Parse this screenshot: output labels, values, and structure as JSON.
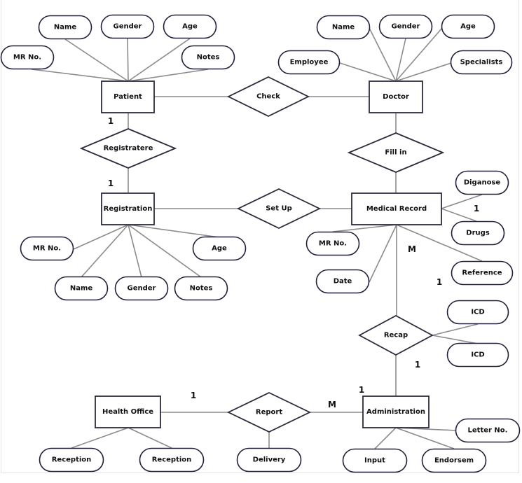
{
  "diagram": {
    "type": "entity-relationship",
    "colors": {
      "shape_stroke": "#2b2b3d",
      "connector": "#8c8c8c",
      "text": "#111111",
      "background": "#ffffff"
    },
    "entities": [
      {
        "id": "patient",
        "label": "Patient"
      },
      {
        "id": "doctor",
        "label": "Doctor"
      },
      {
        "id": "registration",
        "label": "Registration"
      },
      {
        "id": "medical_record",
        "label": "Medical Record"
      },
      {
        "id": "health_office",
        "label": "Health Office"
      },
      {
        "id": "administration",
        "label": "Administration"
      }
    ],
    "relationships": [
      {
        "id": "check",
        "label": "Check",
        "connects": [
          "patient",
          "doctor"
        ]
      },
      {
        "id": "registratere",
        "label": "Registratere",
        "connects": [
          "patient",
          "registration"
        ]
      },
      {
        "id": "fill_in",
        "label": "Fill in",
        "connects": [
          "doctor",
          "medical_record"
        ]
      },
      {
        "id": "set_up",
        "label": "Set Up",
        "connects": [
          "registration",
          "medical_record"
        ]
      },
      {
        "id": "recap",
        "label": "Recap",
        "connects": [
          "medical_record",
          "administration"
        ]
      },
      {
        "id": "report",
        "label": "Report",
        "connects": [
          "health_office",
          "administration"
        ]
      }
    ],
    "attributes": [
      {
        "id": "p_name",
        "label": "Name",
        "owner": "patient"
      },
      {
        "id": "p_gender",
        "label": "Gender",
        "owner": "patient"
      },
      {
        "id": "p_age",
        "label": "Age",
        "owner": "patient"
      },
      {
        "id": "p_mrno",
        "label": "MR No.",
        "owner": "patient"
      },
      {
        "id": "p_notes",
        "label": "Notes",
        "owner": "patient"
      },
      {
        "id": "d_name",
        "label": "Name",
        "owner": "doctor"
      },
      {
        "id": "d_gender",
        "label": "Gender",
        "owner": "doctor"
      },
      {
        "id": "d_age",
        "label": "Age",
        "owner": "doctor"
      },
      {
        "id": "d_employee",
        "label": "Employee",
        "owner": "doctor"
      },
      {
        "id": "d_specialists",
        "label": "Specialists",
        "owner": "doctor"
      },
      {
        "id": "r_mrno",
        "label": "MR No.",
        "owner": "registration"
      },
      {
        "id": "r_age",
        "label": "Age",
        "owner": "registration"
      },
      {
        "id": "r_name",
        "label": "Name",
        "owner": "registration"
      },
      {
        "id": "r_gender",
        "label": "Gender",
        "owner": "registration"
      },
      {
        "id": "r_notes",
        "label": "Notes",
        "owner": "registration"
      },
      {
        "id": "m_diganose",
        "label": "Diganose",
        "owner": "medical_record"
      },
      {
        "id": "m_drugs",
        "label": "Drugs",
        "owner": "medical_record"
      },
      {
        "id": "m_mrno",
        "label": "MR No.",
        "owner": "medical_record"
      },
      {
        "id": "m_reference",
        "label": "Reference",
        "owner": "medical_record"
      },
      {
        "id": "m_date",
        "label": "Date",
        "owner": "medical_record"
      },
      {
        "id": "rc_icd1",
        "label": "ICD",
        "owner": "recap"
      },
      {
        "id": "rc_icd2",
        "label": "ICD",
        "owner": "recap"
      },
      {
        "id": "a_letter",
        "label": "Letter No.",
        "owner": "administration"
      },
      {
        "id": "a_input",
        "label": "Input",
        "owner": "administration"
      },
      {
        "id": "a_endorsem",
        "label": "Endorsem",
        "owner": "administration"
      },
      {
        "id": "h_reception1",
        "label": "Reception",
        "owner": "health_office"
      },
      {
        "id": "h_reception2",
        "label": "Reception",
        "owner": "health_office"
      },
      {
        "id": "rp_delivery",
        "label": "Delivery",
        "owner": "report"
      }
    ],
    "cardinalities": [
      {
        "id": "c1",
        "label": "1",
        "near": "patient-registratere"
      },
      {
        "id": "c2",
        "label": "1",
        "near": "registratere-registration"
      },
      {
        "id": "c3",
        "label": "1",
        "near": "medical_record-diganose"
      },
      {
        "id": "c4",
        "label": "M",
        "near": "medical_record-recap"
      },
      {
        "id": "c5",
        "label": "1",
        "near": "medical_record-reference"
      },
      {
        "id": "c6",
        "label": "1",
        "near": "recap-administration"
      },
      {
        "id": "c7",
        "label": "1",
        "near": "administration-top"
      },
      {
        "id": "c8",
        "label": "1",
        "near": "health_office-report"
      },
      {
        "id": "c9",
        "label": "M",
        "near": "report-administration"
      }
    ]
  }
}
